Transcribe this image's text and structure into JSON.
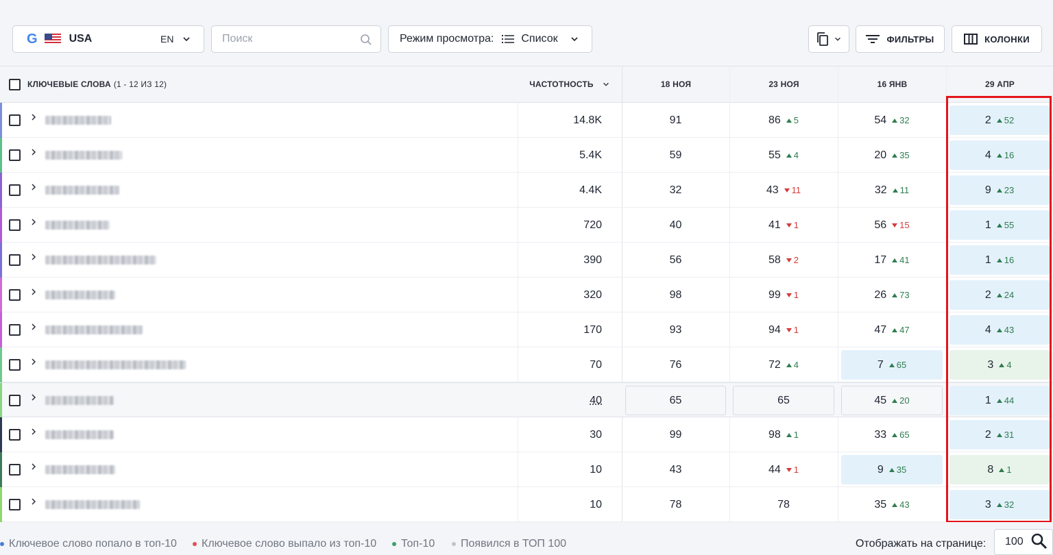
{
  "toolbar": {
    "region": {
      "engine_logo": "G",
      "country": "USA",
      "language": "EN"
    },
    "search": {
      "placeholder": "Поиск",
      "value": ""
    },
    "view_mode": {
      "label": "Режим просмотра:",
      "value": "Список"
    },
    "filters_label": "ФИЛЬТРЫ",
    "columns_label": "КОЛОНКИ"
  },
  "table": {
    "header": {
      "keywords_label": "КЛЮЧЕВЫЕ СЛОВА",
      "keywords_count": "(1 - 12 ИЗ 12)",
      "frequency_label": "ЧАСТОТНОСТЬ",
      "dates": [
        "18 НОЯ",
        "23 НОЯ",
        "16 ЯНВ",
        "29 АПР"
      ]
    },
    "rows": [
      {
        "stripe": "#7b8fd6",
        "freq": "14.8K",
        "cells": [
          {
            "v": "91"
          },
          {
            "v": "86",
            "d": "5",
            "dir": "up"
          },
          {
            "v": "54",
            "d": "32",
            "dir": "up"
          },
          {
            "v": "2",
            "d": "52",
            "dir": "up",
            "bg": "blue"
          }
        ]
      },
      {
        "stripe": "#5cc08a",
        "freq": "5.4K",
        "cells": [
          {
            "v": "59"
          },
          {
            "v": "55",
            "d": "4",
            "dir": "up"
          },
          {
            "v": "20",
            "d": "35",
            "dir": "up"
          },
          {
            "v": "4",
            "d": "16",
            "dir": "up",
            "bg": "blue"
          }
        ]
      },
      {
        "stripe": "#8a63d2",
        "freq": "4.4K",
        "cells": [
          {
            "v": "32"
          },
          {
            "v": "43",
            "d": "11",
            "dir": "down"
          },
          {
            "v": "32",
            "d": "11",
            "dir": "up"
          },
          {
            "v": "9",
            "d": "23",
            "dir": "up",
            "bg": "blue"
          }
        ]
      },
      {
        "stripe": "#b05ad6",
        "freq": "720",
        "cells": [
          {
            "v": "40"
          },
          {
            "v": "41",
            "d": "1",
            "dir": "down"
          },
          {
            "v": "56",
            "d": "15",
            "dir": "down"
          },
          {
            "v": "1",
            "d": "55",
            "dir": "up",
            "bg": "blue"
          }
        ]
      },
      {
        "stripe": "#7a6fd6",
        "freq": "390",
        "cells": [
          {
            "v": "56"
          },
          {
            "v": "58",
            "d": "2",
            "dir": "down"
          },
          {
            "v": "17",
            "d": "41",
            "dir": "up"
          },
          {
            "v": "1",
            "d": "16",
            "dir": "up",
            "bg": "blue"
          }
        ]
      },
      {
        "stripe": "#d06bd6",
        "freq": "320",
        "cells": [
          {
            "v": "98"
          },
          {
            "v": "99",
            "d": "1",
            "dir": "down"
          },
          {
            "v": "26",
            "d": "73",
            "dir": "up"
          },
          {
            "v": "2",
            "d": "24",
            "dir": "up",
            "bg": "blue"
          }
        ]
      },
      {
        "stripe": "#c45fd6",
        "freq": "170",
        "cells": [
          {
            "v": "93"
          },
          {
            "v": "94",
            "d": "1",
            "dir": "down"
          },
          {
            "v": "47",
            "d": "47",
            "dir": "up"
          },
          {
            "v": "4",
            "d": "43",
            "dir": "up",
            "bg": "blue"
          }
        ]
      },
      {
        "stripe": "#6cc98e",
        "freq": "70",
        "cells": [
          {
            "v": "76"
          },
          {
            "v": "72",
            "d": "4",
            "dir": "up"
          },
          {
            "v": "7",
            "d": "65",
            "dir": "up",
            "bg": "blue"
          },
          {
            "v": "3",
            "d": "4",
            "dir": "up",
            "bg": "green"
          }
        ]
      },
      {
        "stripe": "#86d67f",
        "freq": "40",
        "selected": true,
        "cells": [
          {
            "v": "65",
            "bg": "outline"
          },
          {
            "v": "65",
            "bg": "outline"
          },
          {
            "v": "45",
            "d": "20",
            "dir": "up",
            "bg": "outline"
          },
          {
            "v": "1",
            "d": "44",
            "dir": "up",
            "bg": "blue"
          }
        ]
      },
      {
        "stripe": "#2e3a55",
        "freq": "30",
        "cells": [
          {
            "v": "99"
          },
          {
            "v": "98",
            "d": "1",
            "dir": "up"
          },
          {
            "v": "33",
            "d": "65",
            "dir": "up"
          },
          {
            "v": "2",
            "d": "31",
            "dir": "up",
            "bg": "blue"
          }
        ]
      },
      {
        "stripe": "#3d7a5a",
        "freq": "10",
        "cells": [
          {
            "v": "43"
          },
          {
            "v": "44",
            "d": "1",
            "dir": "down"
          },
          {
            "v": "9",
            "d": "35",
            "dir": "up",
            "bg": "blue"
          },
          {
            "v": "8",
            "d": "1",
            "dir": "up",
            "bg": "green"
          }
        ]
      },
      {
        "stripe": "#8fd66f",
        "freq": "10",
        "cells": [
          {
            "v": "78"
          },
          {
            "v": "78"
          },
          {
            "v": "35",
            "d": "43",
            "dir": "up"
          },
          {
            "v": "3",
            "d": "32",
            "dir": "up",
            "bg": "blue"
          }
        ]
      }
    ]
  },
  "footer": {
    "legend": [
      {
        "label": "Ключевое слово попало в топ-10",
        "color": "#4a7fd6"
      },
      {
        "label": "Ключевое слово выпало из топ-10",
        "color": "#e05050"
      },
      {
        "label": "Топ-10",
        "color": "#3da06a"
      },
      {
        "label": "Появился в ТОП 100",
        "color": "#c0c4cb"
      }
    ],
    "per_page_label": "Отображать на странице:",
    "per_page_value": "100"
  },
  "colors": {
    "accent_blue_bg": "#e3f1fb",
    "accent_green_bg": "#e8f4ea",
    "up": "#2f7d4f",
    "down": "#d23c3c",
    "highlight": "#e4141b"
  }
}
